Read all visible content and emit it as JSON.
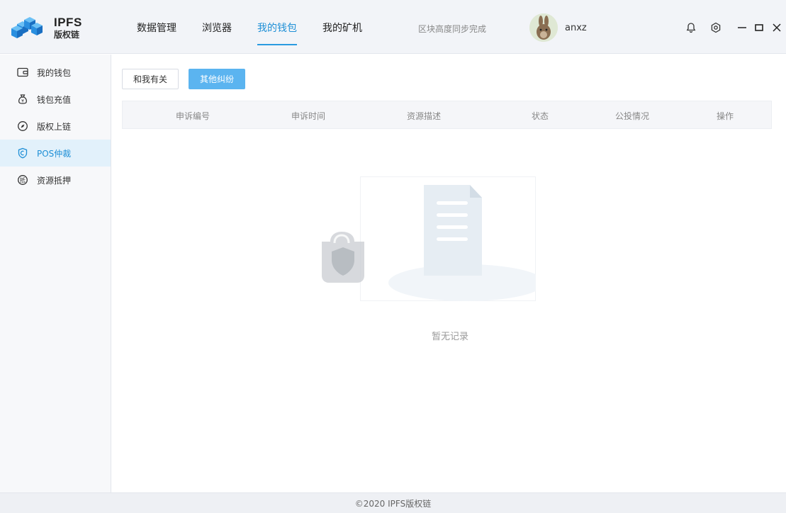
{
  "app": {
    "logo_title": "IPFS",
    "logo_subtitle": "版权链",
    "accent_color": "#1e8fd6"
  },
  "nav": {
    "items": [
      {
        "label": "数据管理",
        "active": false
      },
      {
        "label": "浏览器",
        "active": false
      },
      {
        "label": "我的钱包",
        "active": true
      },
      {
        "label": "我的矿机",
        "active": false
      }
    ]
  },
  "status": {
    "sync_text": "区块高度同步完成"
  },
  "user": {
    "name": "anxz",
    "avatar_icon": "rabbit-avatar"
  },
  "header_icons": [
    "bell-icon",
    "settings-icon",
    "minimize-icon",
    "maximize-icon",
    "close-icon"
  ],
  "sidebar": {
    "items": [
      {
        "label": "我的钱包",
        "icon": "wallet-icon",
        "active": false
      },
      {
        "label": "钱包充值",
        "icon": "money-bag-icon",
        "active": false
      },
      {
        "label": "版权上链",
        "icon": "compass-icon",
        "active": false
      },
      {
        "label": "POS仲裁",
        "icon": "shield-icon",
        "active": true
      },
      {
        "label": "资源抵押",
        "icon": "pledge-icon",
        "active": false
      }
    ]
  },
  "main": {
    "tabs": [
      {
        "label": "和我有关",
        "active": false
      },
      {
        "label": "其他纠纷",
        "active": true
      }
    ],
    "table": {
      "columns": [
        "申诉编号",
        "申诉时间",
        "资源描述",
        "状态",
        "公投情况",
        "操作"
      ],
      "rows": []
    },
    "empty_text": "暂无记录"
  },
  "footer": {
    "copyright": "©2020 IPFS版权链"
  }
}
